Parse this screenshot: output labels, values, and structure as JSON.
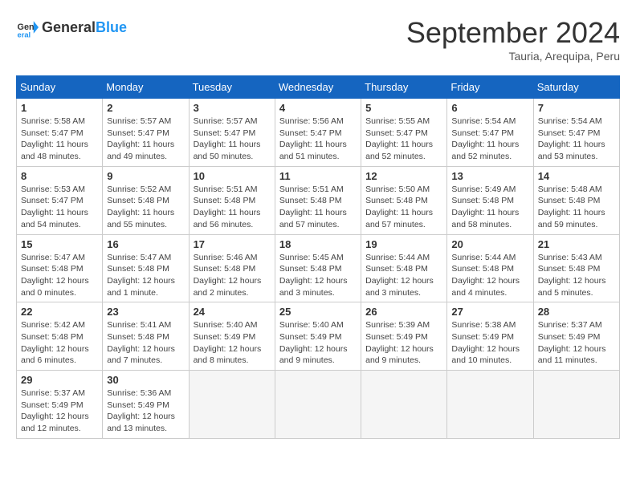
{
  "header": {
    "logo_general": "General",
    "logo_blue": "Blue",
    "month": "September 2024",
    "location": "Tauria, Arequipa, Peru"
  },
  "days_of_week": [
    "Sunday",
    "Monday",
    "Tuesday",
    "Wednesday",
    "Thursday",
    "Friday",
    "Saturday"
  ],
  "weeks": [
    [
      {
        "day": "1",
        "sunrise": "5:58 AM",
        "sunset": "5:47 PM",
        "daylight": "11 hours and 48 minutes."
      },
      {
        "day": "2",
        "sunrise": "5:57 AM",
        "sunset": "5:47 PM",
        "daylight": "11 hours and 49 minutes."
      },
      {
        "day": "3",
        "sunrise": "5:57 AM",
        "sunset": "5:47 PM",
        "daylight": "11 hours and 50 minutes."
      },
      {
        "day": "4",
        "sunrise": "5:56 AM",
        "sunset": "5:47 PM",
        "daylight": "11 hours and 51 minutes."
      },
      {
        "day": "5",
        "sunrise": "5:55 AM",
        "sunset": "5:47 PM",
        "daylight": "11 hours and 52 minutes."
      },
      {
        "day": "6",
        "sunrise": "5:54 AM",
        "sunset": "5:47 PM",
        "daylight": "11 hours and 52 minutes."
      },
      {
        "day": "7",
        "sunrise": "5:54 AM",
        "sunset": "5:47 PM",
        "daylight": "11 hours and 53 minutes."
      }
    ],
    [
      {
        "day": "8",
        "sunrise": "5:53 AM",
        "sunset": "5:47 PM",
        "daylight": "11 hours and 54 minutes."
      },
      {
        "day": "9",
        "sunrise": "5:52 AM",
        "sunset": "5:48 PM",
        "daylight": "11 hours and 55 minutes."
      },
      {
        "day": "10",
        "sunrise": "5:51 AM",
        "sunset": "5:48 PM",
        "daylight": "11 hours and 56 minutes."
      },
      {
        "day": "11",
        "sunrise": "5:51 AM",
        "sunset": "5:48 PM",
        "daylight": "11 hours and 57 minutes."
      },
      {
        "day": "12",
        "sunrise": "5:50 AM",
        "sunset": "5:48 PM",
        "daylight": "11 hours and 57 minutes."
      },
      {
        "day": "13",
        "sunrise": "5:49 AM",
        "sunset": "5:48 PM",
        "daylight": "11 hours and 58 minutes."
      },
      {
        "day": "14",
        "sunrise": "5:48 AM",
        "sunset": "5:48 PM",
        "daylight": "11 hours and 59 minutes."
      }
    ],
    [
      {
        "day": "15",
        "sunrise": "5:47 AM",
        "sunset": "5:48 PM",
        "daylight": "12 hours and 0 minutes."
      },
      {
        "day": "16",
        "sunrise": "5:47 AM",
        "sunset": "5:48 PM",
        "daylight": "12 hours and 1 minute."
      },
      {
        "day": "17",
        "sunrise": "5:46 AM",
        "sunset": "5:48 PM",
        "daylight": "12 hours and 2 minutes."
      },
      {
        "day": "18",
        "sunrise": "5:45 AM",
        "sunset": "5:48 PM",
        "daylight": "12 hours and 3 minutes."
      },
      {
        "day": "19",
        "sunrise": "5:44 AM",
        "sunset": "5:48 PM",
        "daylight": "12 hours and 3 minutes."
      },
      {
        "day": "20",
        "sunrise": "5:44 AM",
        "sunset": "5:48 PM",
        "daylight": "12 hours and 4 minutes."
      },
      {
        "day": "21",
        "sunrise": "5:43 AM",
        "sunset": "5:48 PM",
        "daylight": "12 hours and 5 minutes."
      }
    ],
    [
      {
        "day": "22",
        "sunrise": "5:42 AM",
        "sunset": "5:48 PM",
        "daylight": "12 hours and 6 minutes."
      },
      {
        "day": "23",
        "sunrise": "5:41 AM",
        "sunset": "5:48 PM",
        "daylight": "12 hours and 7 minutes."
      },
      {
        "day": "24",
        "sunrise": "5:40 AM",
        "sunset": "5:49 PM",
        "daylight": "12 hours and 8 minutes."
      },
      {
        "day": "25",
        "sunrise": "5:40 AM",
        "sunset": "5:49 PM",
        "daylight": "12 hours and 9 minutes."
      },
      {
        "day": "26",
        "sunrise": "5:39 AM",
        "sunset": "5:49 PM",
        "daylight": "12 hours and 9 minutes."
      },
      {
        "day": "27",
        "sunrise": "5:38 AM",
        "sunset": "5:49 PM",
        "daylight": "12 hours and 10 minutes."
      },
      {
        "day": "28",
        "sunrise": "5:37 AM",
        "sunset": "5:49 PM",
        "daylight": "12 hours and 11 minutes."
      }
    ],
    [
      {
        "day": "29",
        "sunrise": "5:37 AM",
        "sunset": "5:49 PM",
        "daylight": "12 hours and 12 minutes."
      },
      {
        "day": "30",
        "sunrise": "5:36 AM",
        "sunset": "5:49 PM",
        "daylight": "12 hours and 13 minutes."
      },
      null,
      null,
      null,
      null,
      null
    ]
  ]
}
